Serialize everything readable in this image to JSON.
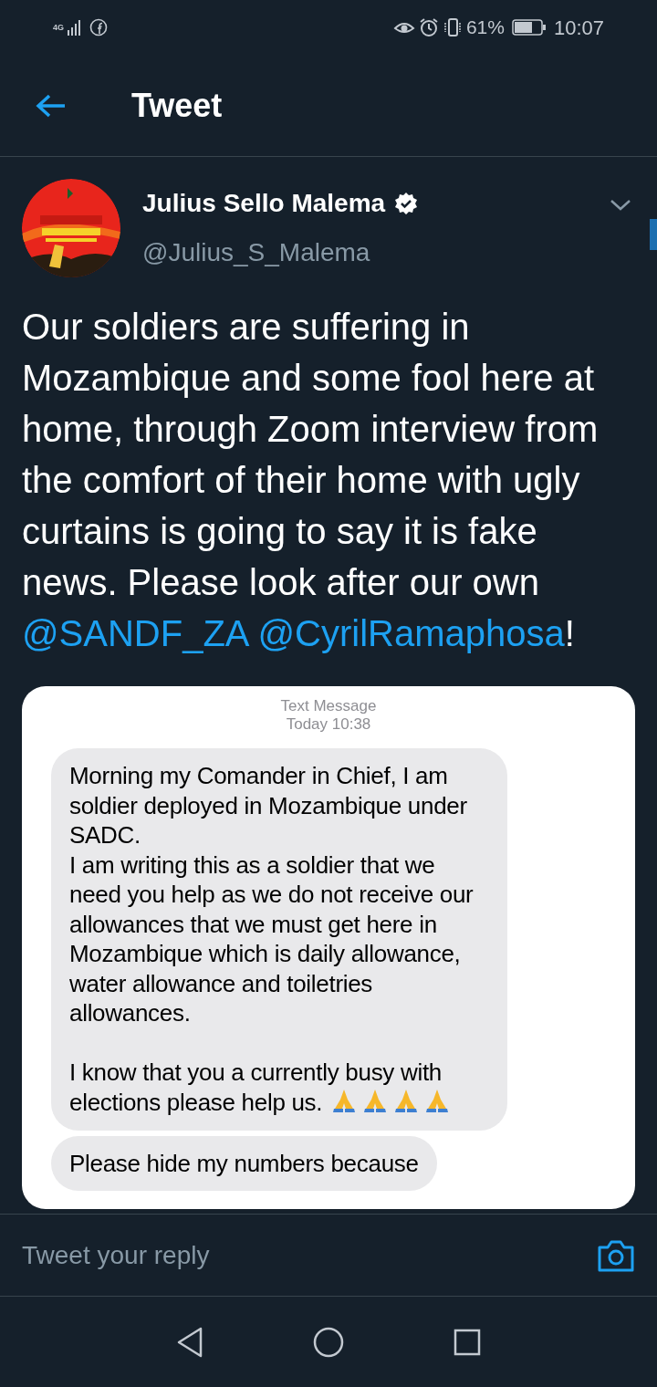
{
  "status_bar": {
    "network": "4G",
    "battery": "61%",
    "time": "10:07"
  },
  "header": {
    "title": "Tweet"
  },
  "tweet": {
    "name": "Julius Sello Malema",
    "verified": true,
    "handle": "@Julius_S_Malema",
    "text": [
      {
        "kind": "text",
        "text": "Our soldiers are suffering in Mozambique and some fool here at home, through Zoom interview from the comfort of their home with ugly curtains is going to say it is fake news. Please look after our own "
      },
      {
        "kind": "mention",
        "text": "@SANDF_ZA"
      },
      {
        "kind": "mention",
        "text": "@CyrilRamaphosa"
      },
      {
        "kind": "text",
        "text": "!"
      }
    ],
    "attachment": {
      "kind": "text_message_screenshot",
      "header": "Text Message",
      "time": "Today 10:38",
      "bubbles": [
        {
          "paragraphs": [
            "Morning my Comander in Chief, I am soldier deployed in Mozambique under SADC.\nI am writing this as a soldier that we need you help as we do not receive our allowances that we must get here in Mozambique which is daily allowance, water allowance and toiletries allowances.",
            "I know that you a currently busy with elections please help us."
          ],
          "praying_hands": true
        },
        {
          "paragraphs": [
            "Please hide my numbers because"
          ],
          "praying_hands": false
        }
      ]
    }
  },
  "reply": {
    "placeholder": "Tweet your reply"
  }
}
